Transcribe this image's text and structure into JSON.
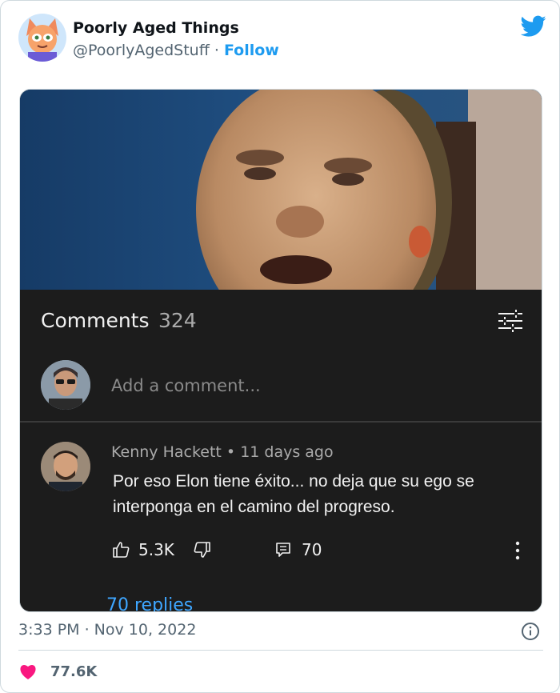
{
  "tweet": {
    "display_name": "Poorly Aged Things",
    "handle": "@PoorlyAgedStuff",
    "separator": "·",
    "follow_label": "Follow",
    "timestamp": "3:33 PM · Nov 10, 2022",
    "likes_count": "77.6K",
    "colors": {
      "accent": "#1d9bf0",
      "heart": "#f91880",
      "muted": "#536471"
    }
  },
  "youtube": {
    "comments_title": "Comments",
    "comments_count": "324",
    "add_comment_placeholder": "Add a comment...",
    "comment": {
      "author": "Kenny Hackett",
      "dot": "•",
      "age": "11 days ago",
      "text": "Por eso Elon tiene éxito... no deja que su ego se interponga en el camino del progreso.",
      "likes": "5.3K",
      "replies_count": "70",
      "replies_link": "70 replies"
    },
    "colors": {
      "background": "#1c1c1c",
      "link": "#3ea6ff"
    }
  },
  "icons": [
    "twitter-bird-icon",
    "filter-sliders-icon",
    "thumbs-up-icon",
    "thumbs-down-icon",
    "reply-icon",
    "more-vertical-icon",
    "info-icon",
    "heart-icon"
  ]
}
